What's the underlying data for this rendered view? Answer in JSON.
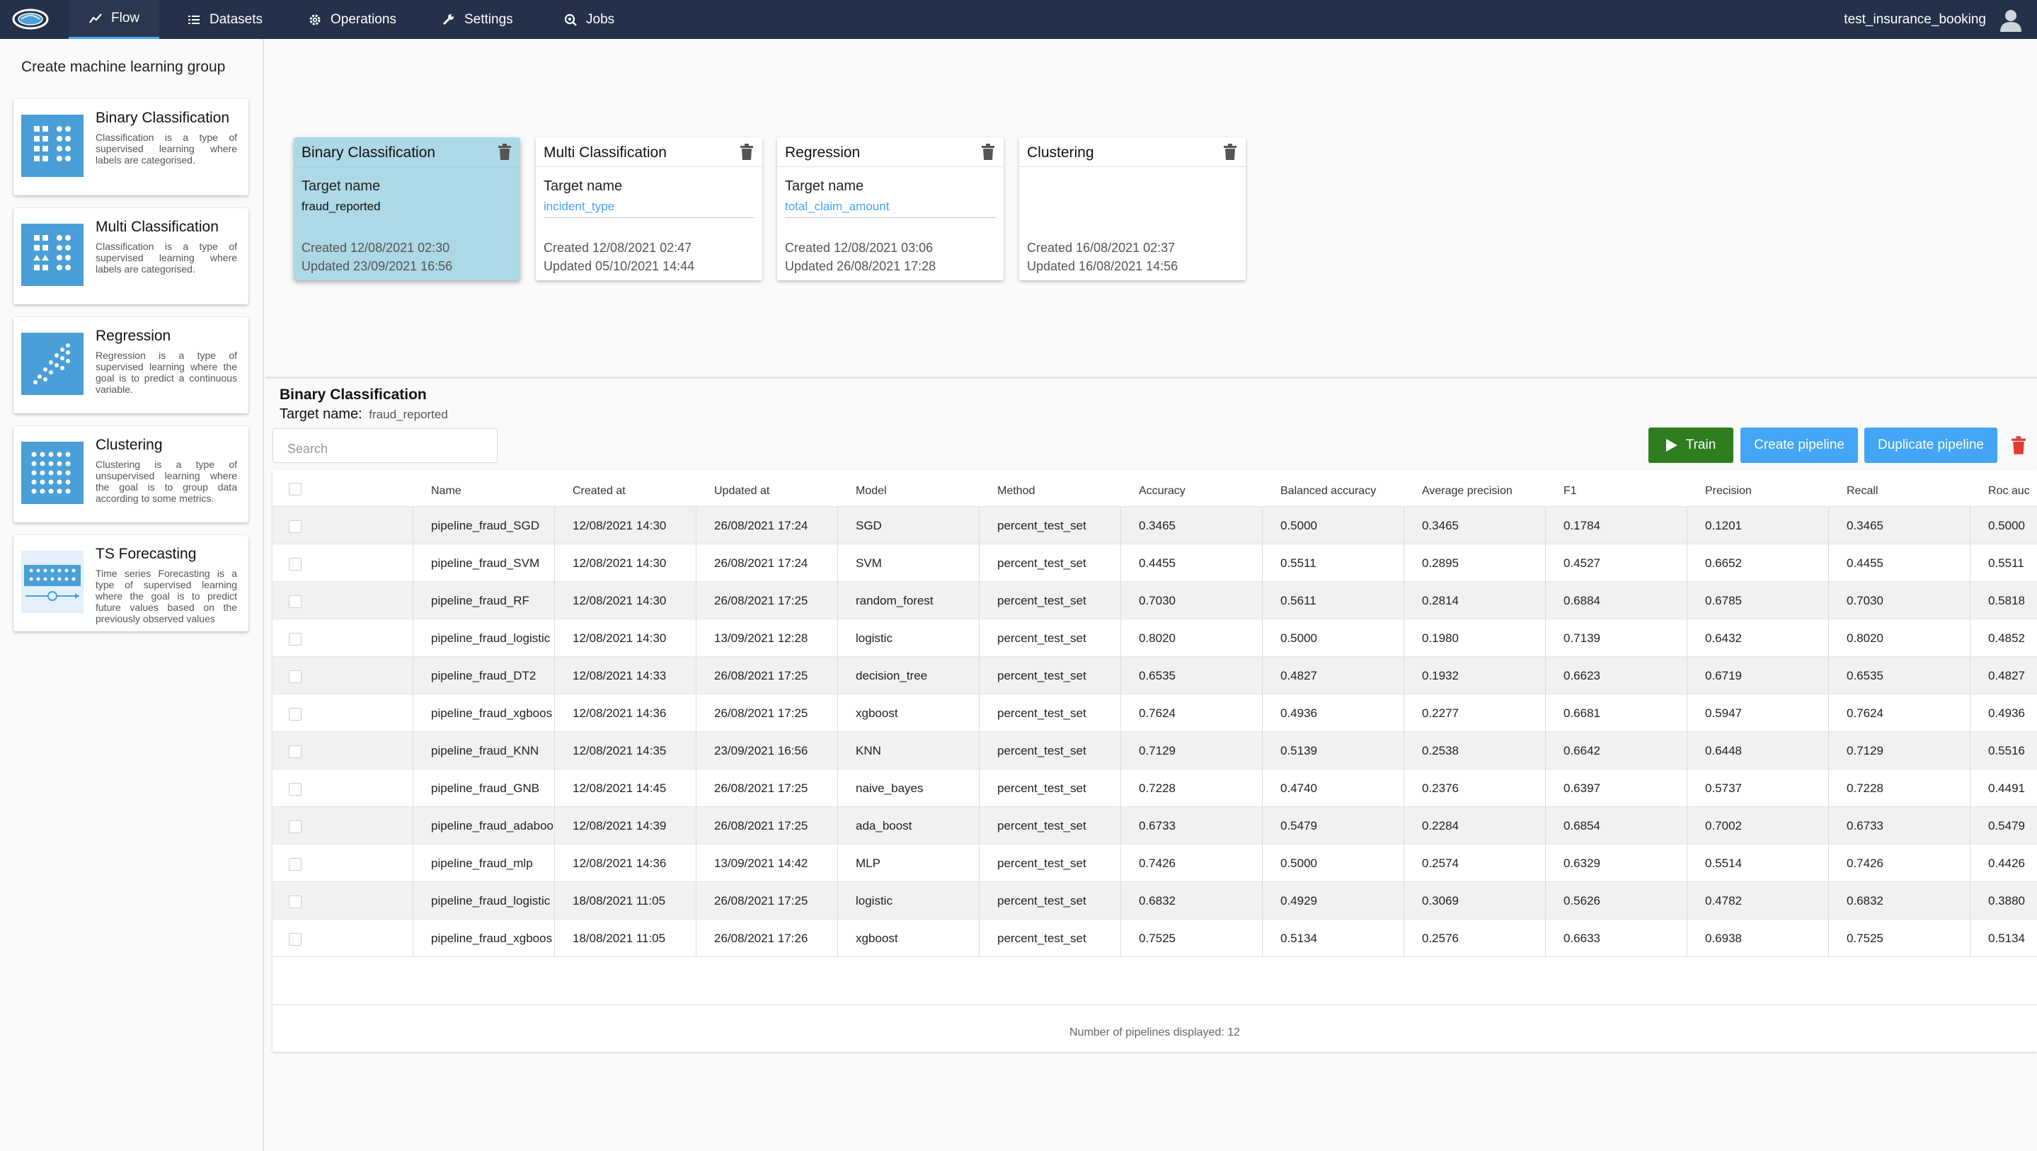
{
  "header": {
    "nav": [
      {
        "label": "Flow",
        "icon": "chart-line-icon"
      },
      {
        "label": "Datasets",
        "icon": "list-icon"
      },
      {
        "label": "Operations",
        "icon": "gear-icon"
      },
      {
        "label": "Settings",
        "icon": "wrench-icon"
      },
      {
        "label": "Jobs",
        "icon": "search-gear-icon"
      }
    ],
    "active_nav": "Flow",
    "user": "test_insurance_booking"
  },
  "sidebar": {
    "title": "Create machine learning group",
    "cards": [
      {
        "title": "Binary Classification",
        "description": "Classification is a type of supervised learning where labels are categorised.",
        "icon": "binary-classification-icon"
      },
      {
        "title": "Multi Classification",
        "description": "Classification is a type of supervised learning where labels are categorised.",
        "icon": "multi-classification-icon"
      },
      {
        "title": "Regression",
        "description": "Regression is a type of supervised learning where the goal is to predict a continuous variable.",
        "icon": "regression-icon"
      },
      {
        "title": "Clustering",
        "description": "Clustering is a type of unsupervised learning where the goal is to group data according to some metrics.",
        "icon": "clustering-icon"
      },
      {
        "title": "TS Forecasting",
        "description": "Time series Forecasting is a type of supervised learning where the goal is to predict future values based on the previously observed values",
        "icon": "ts-forecasting-icon"
      }
    ]
  },
  "groups": [
    {
      "title": "Binary Classification",
      "target_label": "Target name",
      "target": "fraud_reported",
      "created": "Created 12/08/2021 02:30",
      "updated": "Updated 23/09/2021 16:56"
    },
    {
      "title": "Multi Classification",
      "target_label": "Target name",
      "target": "incident_type",
      "created": "Created 12/08/2021 02:47",
      "updated": "Updated 05/10/2021 14:44"
    },
    {
      "title": "Regression",
      "target_label": "Target name",
      "target": "total_claim_amount",
      "created": "Created 12/08/2021 03:06",
      "updated": "Updated 26/08/2021 17:28"
    },
    {
      "title": "Clustering",
      "target_label": "",
      "target": "",
      "created": "Created 16/08/2021 02:37",
      "updated": "Updated 16/08/2021 14:56"
    }
  ],
  "section": {
    "title": "Binary Classification",
    "target_label": "Target name:",
    "target_value": "fraud_reported",
    "search_placeholder": "Search",
    "buttons": {
      "train": "Train",
      "create": "Create pipeline",
      "duplicate": "Duplicate pipeline"
    }
  },
  "table": {
    "columns": [
      "Name",
      "Created at",
      "Updated at",
      "Model",
      "Method",
      "Accuracy",
      "Balanced accuracy",
      "Average precision",
      "F1",
      "Precision",
      "Recall",
      "Roc auc"
    ],
    "rows": [
      [
        "pipeline_fraud_SGD",
        "12/08/2021 14:30",
        "26/08/2021 17:24",
        "SGD",
        "percent_test_set",
        "0.3465",
        "0.5000",
        "0.3465",
        "0.1784",
        "0.1201",
        "0.3465",
        "0.5000"
      ],
      [
        "pipeline_fraud_SVM",
        "12/08/2021 14:30",
        "26/08/2021 17:24",
        "SVM",
        "percent_test_set",
        "0.4455",
        "0.5511",
        "0.2895",
        "0.4527",
        "0.6652",
        "0.4455",
        "0.5511"
      ],
      [
        "pipeline_fraud_RF",
        "12/08/2021 14:30",
        "26/08/2021 17:25",
        "random_forest",
        "percent_test_set",
        "0.7030",
        "0.5611",
        "0.2814",
        "0.6884",
        "0.6785",
        "0.7030",
        "0.5818"
      ],
      [
        "pipeline_fraud_logistic",
        "12/08/2021 14:30",
        "13/09/2021 12:28",
        "logistic",
        "percent_test_set",
        "0.8020",
        "0.5000",
        "0.1980",
        "0.7139",
        "0.6432",
        "0.8020",
        "0.4852"
      ],
      [
        "pipeline_fraud_DT2",
        "12/08/2021 14:33",
        "26/08/2021 17:25",
        "decision_tree",
        "percent_test_set",
        "0.6535",
        "0.4827",
        "0.1932",
        "0.6623",
        "0.6719",
        "0.6535",
        "0.4827"
      ],
      [
        "pipeline_fraud_xgboos",
        "12/08/2021 14:36",
        "26/08/2021 17:25",
        "xgboost",
        "percent_test_set",
        "0.7624",
        "0.4936",
        "0.2277",
        "0.6681",
        "0.5947",
        "0.7624",
        "0.4936"
      ],
      [
        "pipeline_fraud_KNN",
        "12/08/2021 14:35",
        "23/09/2021 16:56",
        "KNN",
        "percent_test_set",
        "0.7129",
        "0.5139",
        "0.2538",
        "0.6642",
        "0.6448",
        "0.7129",
        "0.5516"
      ],
      [
        "pipeline_fraud_GNB",
        "12/08/2021 14:45",
        "26/08/2021 17:25",
        "naive_bayes",
        "percent_test_set",
        "0.7228",
        "0.4740",
        "0.2376",
        "0.6397",
        "0.5737",
        "0.7228",
        "0.4491"
      ],
      [
        "pipeline_fraud_adaboo",
        "12/08/2021 14:39",
        "26/08/2021 17:25",
        "ada_boost",
        "percent_test_set",
        "0.6733",
        "0.5479",
        "0.2284",
        "0.6854",
        "0.7002",
        "0.6733",
        "0.5479"
      ],
      [
        "pipeline_fraud_mlp",
        "12/08/2021 14:36",
        "13/09/2021 14:42",
        "MLP",
        "percent_test_set",
        "0.7426",
        "0.5000",
        "0.2574",
        "0.6329",
        "0.5514",
        "0.7426",
        "0.4426"
      ],
      [
        "pipeline_fraud_logistic",
        "18/08/2021 11:05",
        "26/08/2021 17:25",
        "logistic",
        "percent_test_set",
        "0.6832",
        "0.4929",
        "0.3069",
        "0.5626",
        "0.4782",
        "0.6832",
        "0.3880"
      ],
      [
        "pipeline_fraud_xgboos",
        "18/08/2021 11:05",
        "26/08/2021 17:26",
        "xgboost",
        "percent_test_set",
        "0.7525",
        "0.5134",
        "0.2576",
        "0.6633",
        "0.6938",
        "0.7525",
        "0.5134"
      ]
    ],
    "footer": "Number of pipelines displayed: 12"
  }
}
